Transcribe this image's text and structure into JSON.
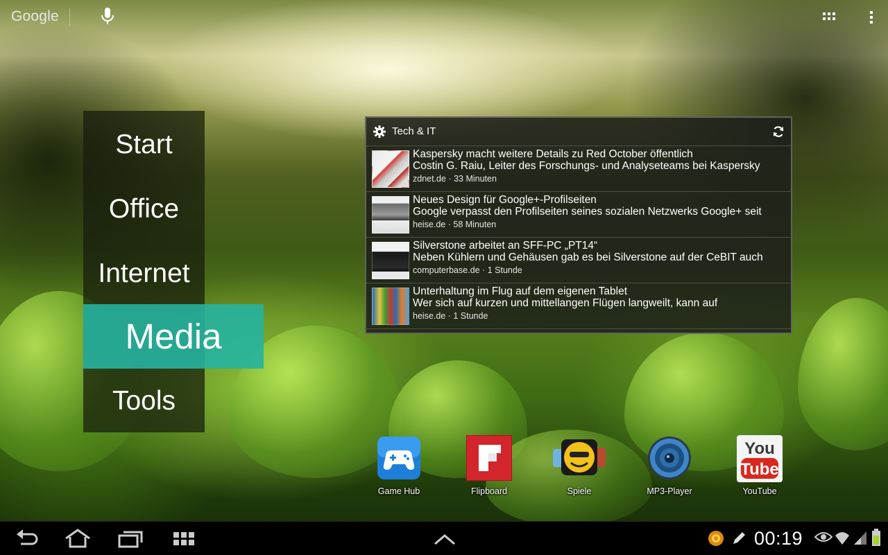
{
  "search_bar": {
    "brand": "Google",
    "mic_icon": "microphone-icon"
  },
  "top_right": {
    "apps_icon": "app-grid-icon",
    "menu_icon": "overflow-menu-icon"
  },
  "side_menu": {
    "items": [
      {
        "label": "Start",
        "active": false
      },
      {
        "label": "Office",
        "active": false
      },
      {
        "label": "Internet",
        "active": false
      },
      {
        "label": "Media",
        "active": true
      },
      {
        "label": "Tools",
        "active": false
      }
    ],
    "accent_color": "#26b2a0"
  },
  "news_widget": {
    "title": "Tech & IT",
    "items": [
      {
        "headline": "Kaspersky macht weitere Details zu Red October öffentlich",
        "teaser": "Costin G. Raiu, Leiter des Forschungs- und Analyseteams bei Kaspersky",
        "source": "zdnet.de",
        "age": "33 Minuten"
      },
      {
        "headline": "Neues Design für Google+-Profilseiten",
        "teaser": "Google verpasst den Profilseiten seines sozialen Netzwerks Google+ seit",
        "source": "heise.de",
        "age": "58 Minuten"
      },
      {
        "headline": "Silverstone arbeitet an SFF-PC „PT14“",
        "teaser": "Neben Kühlern und Gehäusen gab es bei Silverstone auf der CeBIT auch",
        "source": "computerbase.de",
        "age": "1 Stunde"
      },
      {
        "headline": "Unterhaltung im Flug auf dem eigenen Tablet",
        "teaser": "Wer sich auf kurzen und mittellangen Flügen langweilt, kann auf",
        "source": "heise.de",
        "age": "1 Stunde"
      }
    ]
  },
  "apps": [
    {
      "label": "Game Hub",
      "icon": "gamepad-icon"
    },
    {
      "label": "Flipboard",
      "icon": "flipboard-icon"
    },
    {
      "label": "Spiele",
      "icon": "games-folder-icon"
    },
    {
      "label": "MP3-Player",
      "icon": "speaker-icon"
    },
    {
      "label": "YouTube",
      "icon": "youtube-icon"
    }
  ],
  "navbar": {
    "time": "00:19",
    "buttons": [
      "back-icon",
      "home-icon",
      "recent-apps-icon",
      "screenshot-grid-icon",
      "expand-up-icon"
    ],
    "status_icons": [
      "notification-icon",
      "pen-icon",
      "eye-icon",
      "wifi-icon",
      "signal-icon",
      "battery-icon"
    ]
  }
}
